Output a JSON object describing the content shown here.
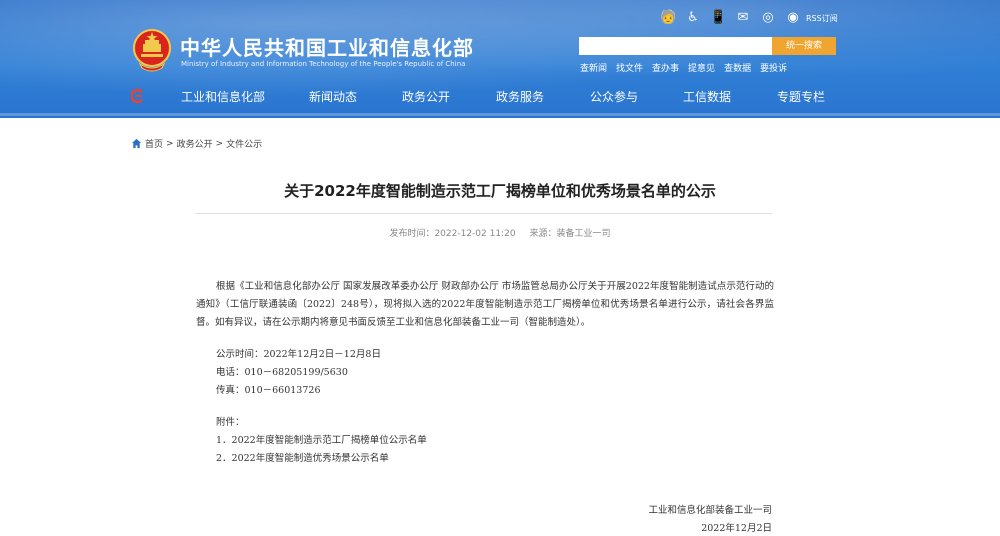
{
  "header": {
    "site_name_cn": "中华人民共和国工业和信息化部",
    "site_name_en": "Ministry of Industry and Information Technology of the People's Republic of China",
    "rss_label": "RSS订阅",
    "search_placeholder": "",
    "search_button": "统一搜索",
    "quick_links": [
      "查新闻",
      "找文件",
      "查办事",
      "提意见",
      "查数据",
      "要投诉"
    ]
  },
  "nav": {
    "items": [
      "工业和信息化部",
      "新闻动态",
      "政务公开",
      "政务服务",
      "公众参与",
      "工信数据",
      "专题专栏"
    ]
  },
  "breadcrumb": {
    "home": "首页",
    "sep": ">",
    "level1": "政务公开",
    "level2": "文件公示"
  },
  "article": {
    "title": "关于2022年度智能制造示范工厂揭榜单位和优秀场景名单的公示",
    "publish_time": "发布时间：2022-12-02 11:20",
    "source": "来源：装备工业一司",
    "paragraph1_line1": "根据《工业和信息化部办公厅 国家发展改革委办公厅 财政部办公厅 市场监管总局办公厅关于开展2022年度智能制造试点",
    "paragraph1_line2": "示范行动的通知》（工信厅联通装函〔2022〕248号），现将拟入选的2022年度智能制造示范工厂揭榜单位和优秀场景名单进行",
    "paragraph1_line3": "公示，请社会各界监督。如有异议，请在公示期内将意见书面反馈至工业和信息化部装备工业一司（智能制造处）。",
    "notice_period": "公示时间：2022年12月2日－12月8日",
    "phone": "电话：010－68205199/5630",
    "fax": "传真：010－66013726",
    "attachments_label": "附件：",
    "attachments": [
      "1．2022年度智能制造示范工厂揭榜单位公示名单",
      "2．2022年度智能制造优秀场景公示名单"
    ],
    "sign_org": "工业和信息化部装备工业一司",
    "sign_date": "2022年12月2日"
  }
}
